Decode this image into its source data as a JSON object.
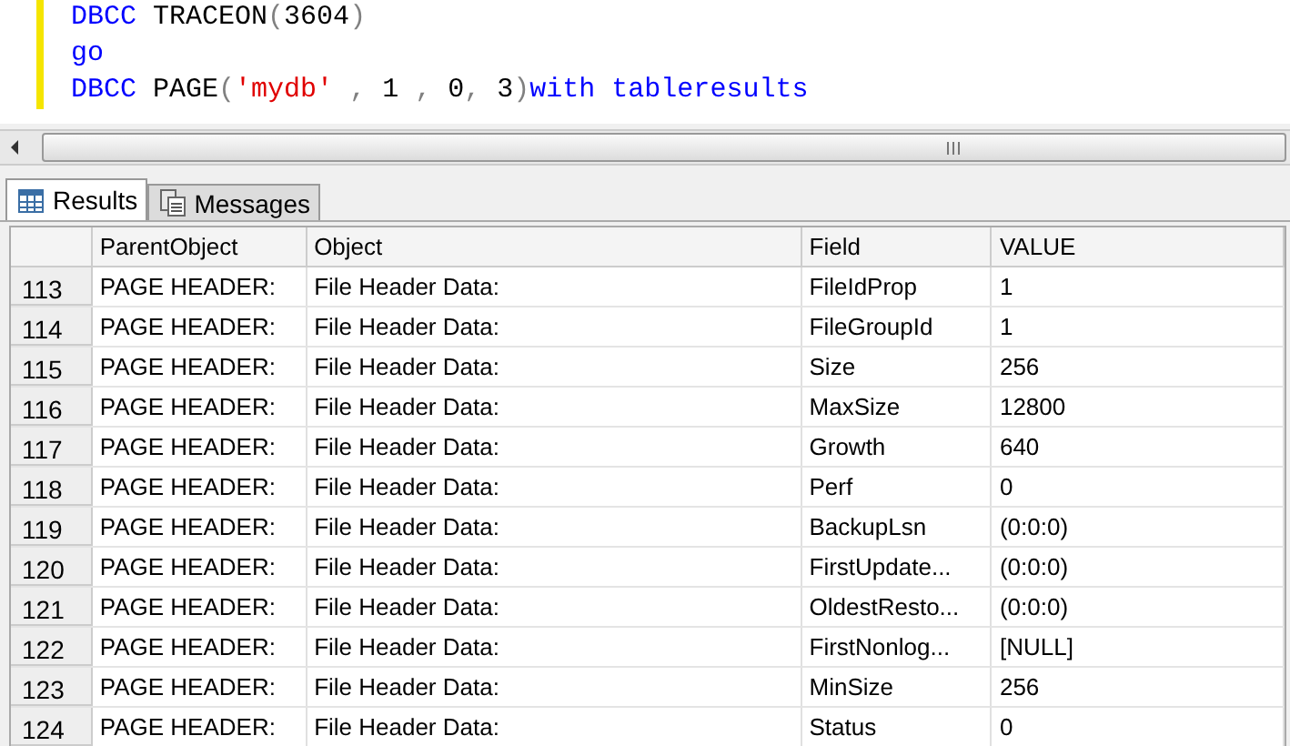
{
  "editor": {
    "lines": [
      [
        {
          "text": "DBCC",
          "kind": "keyword"
        },
        {
          "text": " TRACEON",
          "kind": "plain"
        },
        {
          "text": "(",
          "kind": "punct"
        },
        {
          "text": "3604",
          "kind": "plain"
        },
        {
          "text": ")",
          "kind": "punct"
        }
      ],
      [
        {
          "text": "go",
          "kind": "keyword"
        }
      ],
      [
        {
          "text": "DBCC",
          "kind": "keyword"
        },
        {
          "text": " PAGE",
          "kind": "plain"
        },
        {
          "text": "(",
          "kind": "punct"
        },
        {
          "text": "'mydb'",
          "kind": "string"
        },
        {
          "text": " , ",
          "kind": "punct"
        },
        {
          "text": "1",
          "kind": "plain"
        },
        {
          "text": " , ",
          "kind": "punct"
        },
        {
          "text": "0",
          "kind": "plain"
        },
        {
          "text": ", ",
          "kind": "punct"
        },
        {
          "text": "3",
          "kind": "plain"
        },
        {
          "text": ")",
          "kind": "punct"
        },
        {
          "text": "with tableresults",
          "kind": "keyword"
        }
      ]
    ]
  },
  "tabs": [
    {
      "label": "Results",
      "selected": true,
      "kind": "grid"
    },
    {
      "label": "Messages",
      "selected": false,
      "kind": "messages"
    }
  ],
  "table": {
    "columns": [
      "ParentObject",
      "Object",
      "Field",
      "VALUE"
    ],
    "rows": [
      {
        "number": "113",
        "cells": [
          "PAGE HEADER:",
          "File Header Data:",
          "FileIdProp",
          "1"
        ]
      },
      {
        "number": "114",
        "cells": [
          "PAGE HEADER:",
          "File Header Data:",
          "FileGroupId",
          "1"
        ]
      },
      {
        "number": "115",
        "cells": [
          "PAGE HEADER:",
          "File Header Data:",
          "Size",
          "256"
        ]
      },
      {
        "number": "116",
        "cells": [
          "PAGE HEADER:",
          "File Header Data:",
          "MaxSize",
          "12800"
        ]
      },
      {
        "number": "117",
        "cells": [
          "PAGE HEADER:",
          "File Header Data:",
          "Growth",
          "640"
        ]
      },
      {
        "number": "118",
        "cells": [
          "PAGE HEADER:",
          "File Header Data:",
          "Perf",
          "0"
        ]
      },
      {
        "number": "119",
        "cells": [
          "PAGE HEADER:",
          "File Header Data:",
          "BackupLsn",
          "(0:0:0)"
        ]
      },
      {
        "number": "120",
        "cells": [
          "PAGE HEADER:",
          "File Header Data:",
          "FirstUpdate...",
          "(0:0:0)"
        ]
      },
      {
        "number": "121",
        "cells": [
          "PAGE HEADER:",
          "File Header Data:",
          "OldestResto...",
          "(0:0:0)"
        ]
      },
      {
        "number": "122",
        "cells": [
          "PAGE HEADER:",
          "File Header Data:",
          "FirstNonlog...",
          "[NULL]"
        ]
      },
      {
        "number": "123",
        "cells": [
          "PAGE HEADER:",
          "File Header Data:",
          "MinSize",
          "256"
        ]
      },
      {
        "number": "124",
        "cells": [
          "PAGE HEADER:",
          "File Header Data:",
          "Status",
          "0"
        ]
      }
    ]
  }
}
